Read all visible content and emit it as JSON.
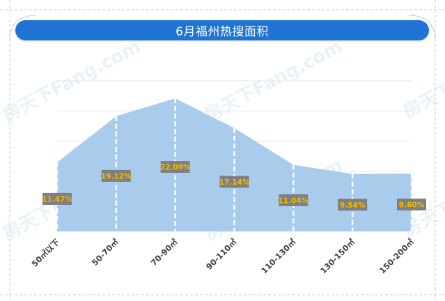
{
  "chart_data": {
    "type": "area",
    "title": "6月福州热搜面积",
    "categories": [
      "50㎡以下",
      "50-70㎡",
      "70-90㎡",
      "90-110㎡",
      "110-130㎡",
      "130-150㎡",
      "150-200㎡"
    ],
    "series": [
      {
        "values": [
          11.47,
          19.12,
          22.09,
          17.14,
          11.04,
          9.54,
          9.6
        ]
      }
    ],
    "data_labels": [
      "11.47%",
      "19.12%",
      "22.09%",
      "17.14%",
      "11.04%",
      "9.54%",
      "9.60%"
    ],
    "ylim": [
      0,
      25
    ],
    "y_axis_visible": false,
    "grid": true,
    "legend": "none",
    "colors": {
      "area": "#a9cbec",
      "title_bar": "#1f74d6",
      "label_box": "#7f7f7f",
      "label_text": "#f5b800",
      "grid": "#e6e6e6",
      "drop_lines": "#ffffff",
      "frame": "#b9cfe6",
      "axis_text": "#404040"
    }
  },
  "watermark": "房天下Fang.com"
}
